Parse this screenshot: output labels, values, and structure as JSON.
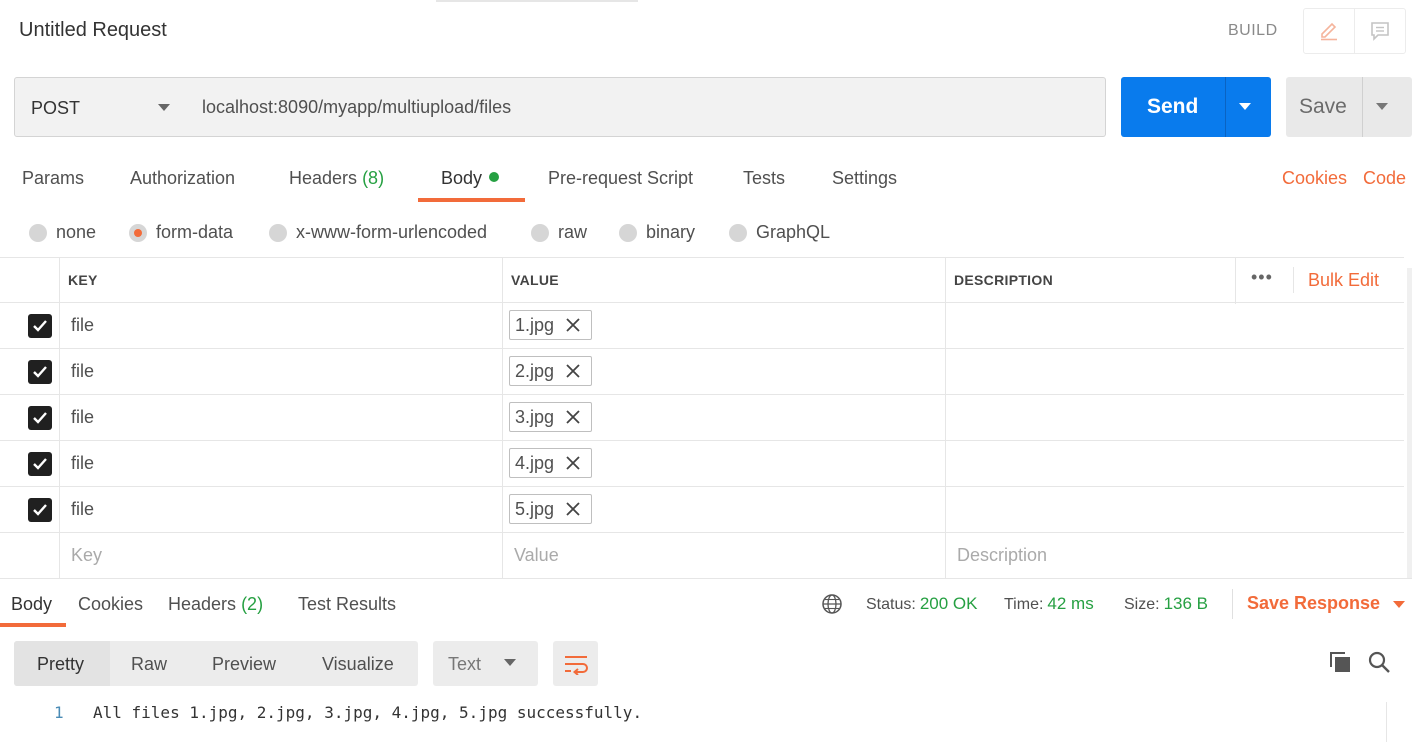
{
  "request": {
    "title": "Untitled Request",
    "build_label": "BUILD",
    "method": "POST",
    "url": "localhost:8090/myapp/multiupload/files",
    "send_label": "Send",
    "save_label": "Save"
  },
  "request_tabs": {
    "params": "Params",
    "authorization": "Authorization",
    "headers": "Headers",
    "headers_count": "(8)",
    "body": "Body",
    "pre_request": "Pre-request Script",
    "tests": "Tests",
    "settings": "Settings",
    "cookies": "Cookies",
    "code": "Code"
  },
  "body_types": {
    "none": "none",
    "form_data": "form-data",
    "urlencoded": "x-www-form-urlencoded",
    "raw": "raw",
    "binary": "binary",
    "graphql": "GraphQL",
    "selected": "form-data"
  },
  "params_table": {
    "headers": {
      "key": "KEY",
      "value": "VALUE",
      "description": "DESCRIPTION",
      "bulk_edit": "Bulk Edit",
      "more": "•••"
    },
    "rows": [
      {
        "key": "file",
        "value": "1.jpg",
        "checked": true
      },
      {
        "key": "file",
        "value": "2.jpg",
        "checked": true
      },
      {
        "key": "file",
        "value": "3.jpg",
        "checked": true
      },
      {
        "key": "file",
        "value": "4.jpg",
        "checked": true
      },
      {
        "key": "file",
        "value": "5.jpg",
        "checked": true
      }
    ],
    "placeholders": {
      "key": "Key",
      "value": "Value",
      "description": "Description"
    }
  },
  "response": {
    "tabs": {
      "body": "Body",
      "cookies": "Cookies",
      "headers": "Headers",
      "headers_count": "(2)",
      "test_results": "Test Results"
    },
    "status_label": "Status:",
    "status_value": "200 OK",
    "time_label": "Time:",
    "time_value": "42 ms",
    "size_label": "Size:",
    "size_value": "136 B",
    "save_response": "Save Response",
    "views": {
      "pretty": "Pretty",
      "raw": "Raw",
      "preview": "Preview",
      "visualize": "Visualize"
    },
    "format": "Text",
    "lines": [
      {
        "number": "1",
        "text": "All files 1.jpg, 2.jpg, 3.jpg, 4.jpg, 5.jpg successfully."
      }
    ]
  },
  "colors": {
    "accent_orange": "#f26b3a",
    "send_blue": "#097bed",
    "status_green": "#26a042"
  }
}
